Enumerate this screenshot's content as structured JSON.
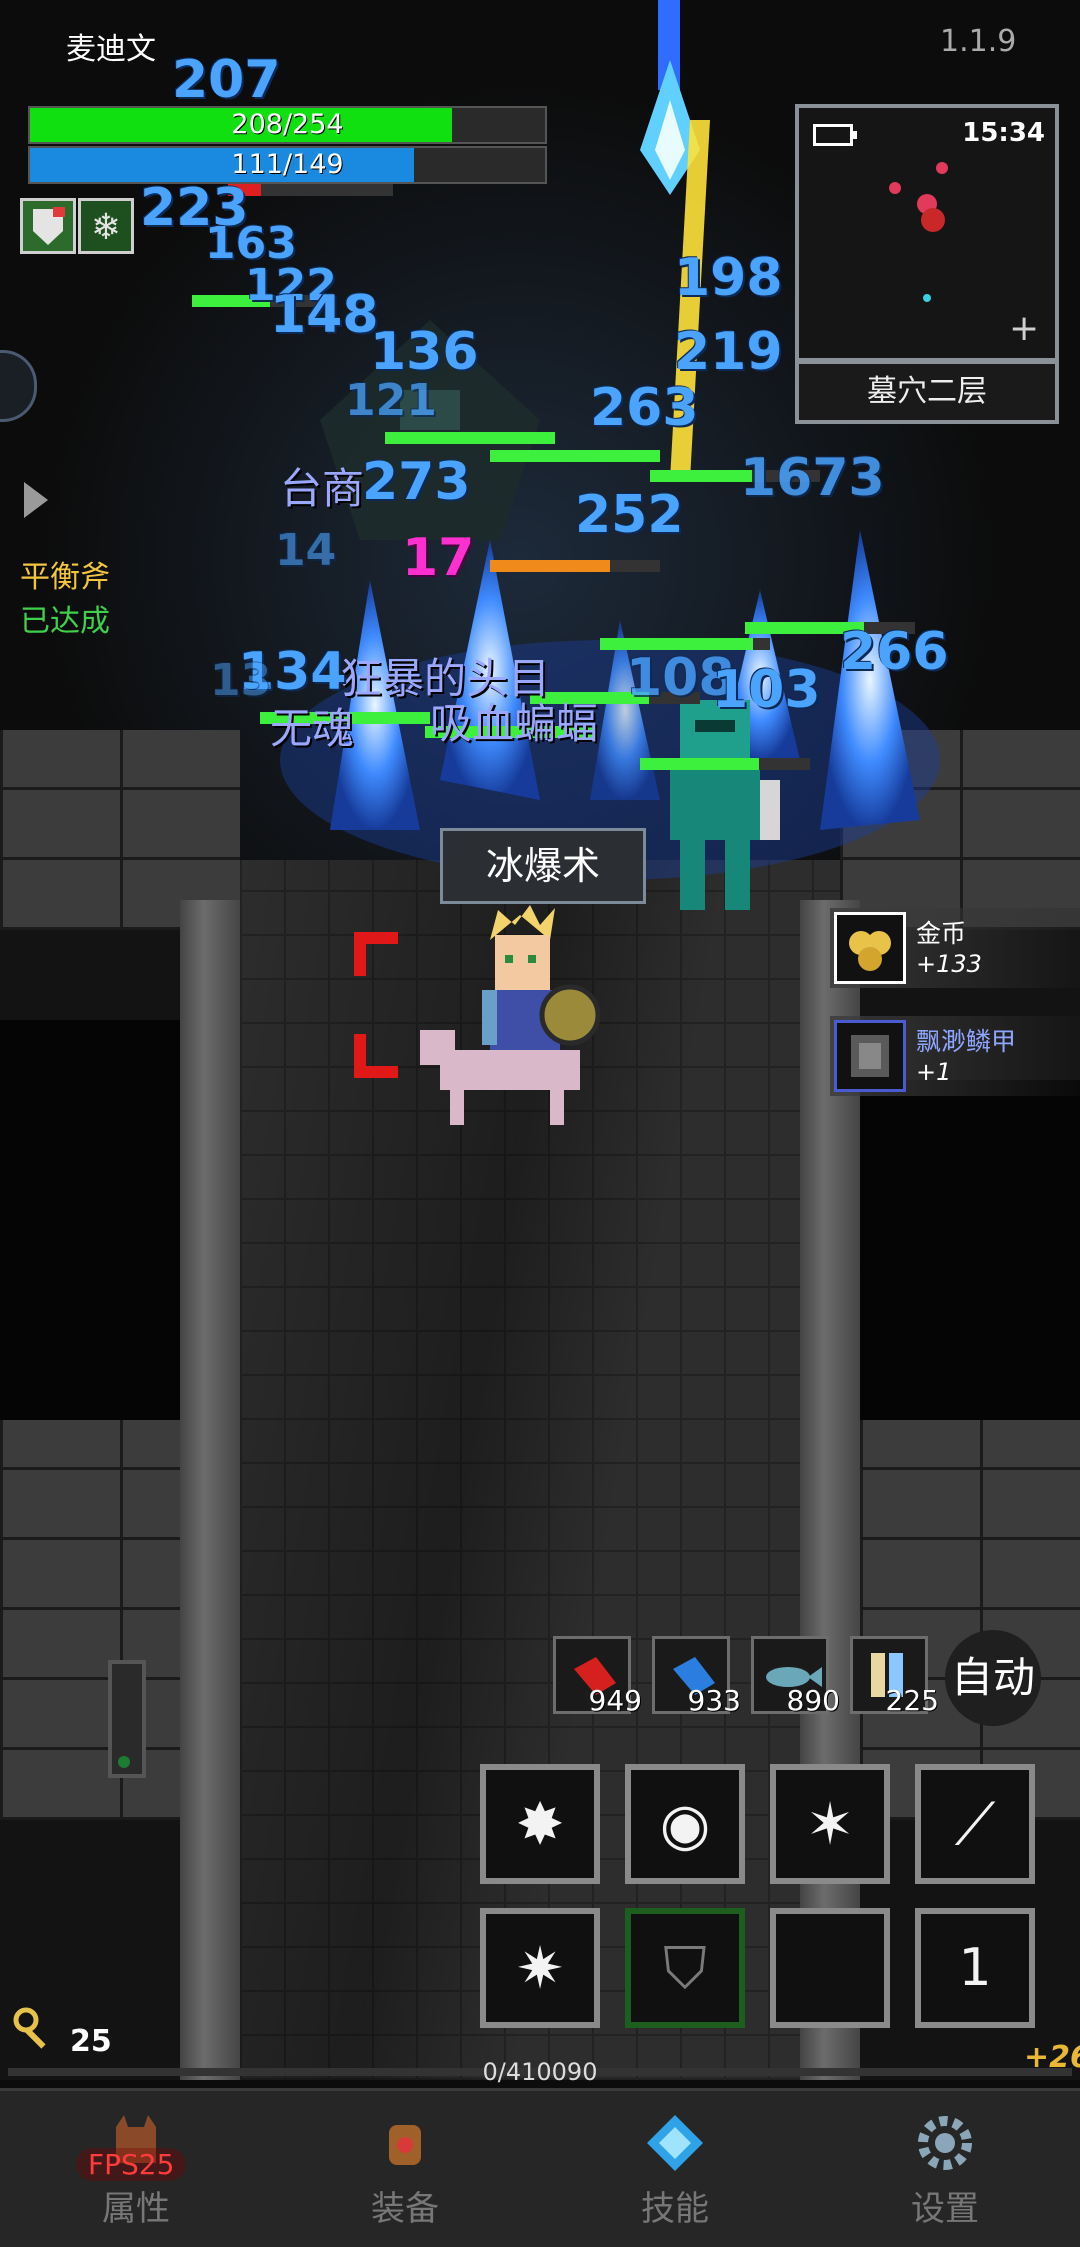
{
  "header": {
    "player_name": "麦迪文",
    "version": "1.1.9"
  },
  "player": {
    "hp_text": "208/254",
    "hp_fraction": 0.8189,
    "mp_text": "111/149",
    "mp_fraction": 0.745
  },
  "minimap": {
    "time": "15:34",
    "location": "墓穴二层"
  },
  "damage_numbers": [
    "207",
    "223",
    "163",
    "122",
    "148",
    "136",
    "121",
    "198",
    "219",
    "263",
    "273",
    "252",
    "17",
    "14",
    "134",
    "266",
    "108",
    "103",
    "1673",
    "13"
  ],
  "enemy_names": [
    "台商",
    "狂暴的头目",
    "吸血蝙蝠",
    "无魂"
  ],
  "quest": {
    "item": "平衡斧",
    "status": "已达成"
  },
  "skill_toast": "冰爆术",
  "loot": [
    {
      "name": "金币",
      "amount": "+133",
      "name_color": "#ffffff"
    },
    {
      "name": "飘渺鳞甲",
      "amount": "+1",
      "name_color": "#8fa6ff"
    }
  ],
  "consumables": [
    {
      "icon": "red-potion-icon",
      "count": "949"
    },
    {
      "icon": "blue-potion-icon",
      "count": "933"
    },
    {
      "icon": "fish-icon",
      "count": "890"
    },
    {
      "icon": "scroll-icon",
      "count": "225"
    }
  ],
  "auto_button": "自动",
  "skills": [
    {
      "icon": "ice-burst-icon",
      "glyph": "✸"
    },
    {
      "icon": "frost-ring-icon",
      "glyph": "◉"
    },
    {
      "icon": "ice-shard-icon",
      "glyph": "✶"
    },
    {
      "icon": "ice-spear-icon",
      "glyph": "⟋"
    },
    {
      "icon": "blizzard-icon",
      "glyph": "✷"
    },
    {
      "icon": "ice-shield-icon",
      "glyph": "⛉"
    },
    {
      "icon": "empty-slot",
      "glyph": ""
    },
    {
      "icon": "skill-page-icon",
      "glyph": "1"
    }
  ],
  "keys": {
    "count": "25"
  },
  "exp": {
    "text": "0/410090",
    "bonus": "+26"
  },
  "fps": "FPS25",
  "nav": [
    {
      "label": "属性",
      "icon": "attributes-icon"
    },
    {
      "label": "装备",
      "icon": "equipment-icon"
    },
    {
      "label": "技能",
      "icon": "skills-icon"
    },
    {
      "label": "设置",
      "icon": "settings-icon"
    }
  ]
}
